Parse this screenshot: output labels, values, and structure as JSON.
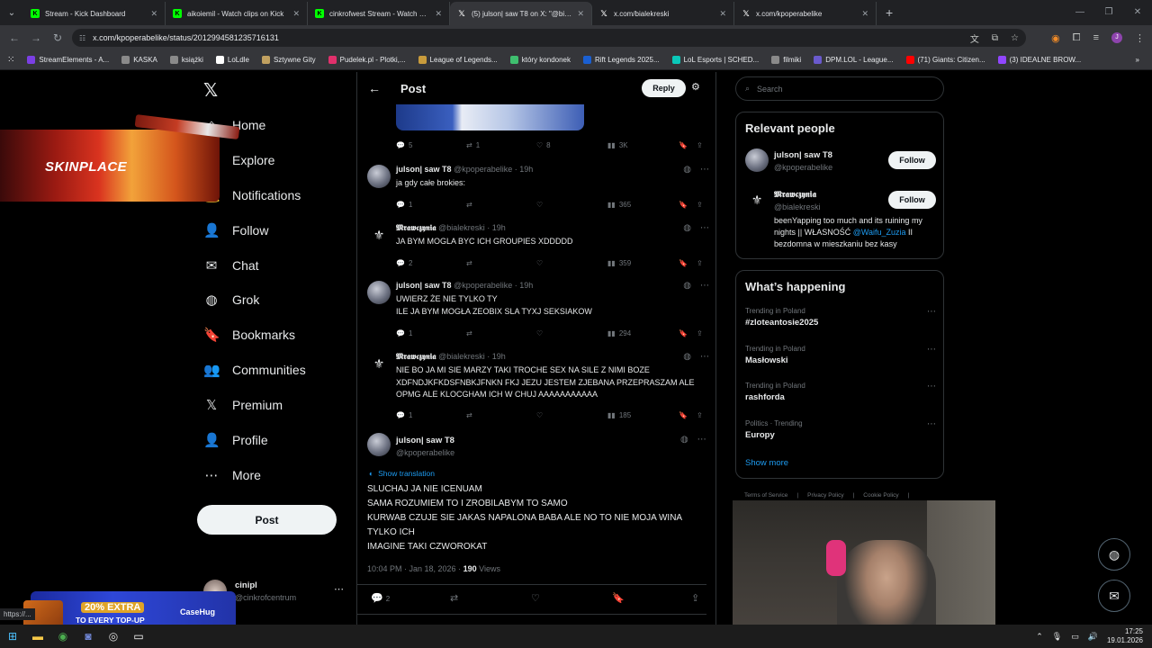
{
  "browser": {
    "tabs": [
      {
        "title": "Stream - Kick Dashboard",
        "icon": "kick-icon",
        "active": false
      },
      {
        "title": "aikoiemil - Watch clips on Kick",
        "icon": "kick-icon",
        "active": false
      },
      {
        "title": "cinkrofwest Stream - Watch Live",
        "icon": "kick-icon",
        "active": false
      },
      {
        "title": "(5) julson| saw T8 on X: \"@bialekreski",
        "icon": "x-icon",
        "active": true
      },
      {
        "title": "x.com/bialekreski",
        "icon": "x-icon",
        "active": false
      },
      {
        "title": "x.com/kpoperabelike",
        "icon": "x-icon",
        "active": false
      }
    ],
    "url": "x.com/kpoperabelike/status/2012994581235716131",
    "bookmarks": [
      "StreamElements - A...",
      "KASKA",
      "książki",
      "LoLdle",
      "Sztywne Gity",
      "Pudelek.pl - Plotki,...",
      "League of Legends...",
      "który kondonek",
      "Rift Legends 2025...",
      "LoL Esports | SCHED...",
      "filmiki",
      "DPM.LOL - League...",
      "(71) Giants: Citizen...",
      "(3) IDEALNE BROW..."
    ],
    "status_url": "https://..."
  },
  "sidebar": {
    "items": [
      {
        "label": "Home",
        "icon": "home-icon",
        "glyph": "⌂"
      },
      {
        "label": "Explore",
        "icon": "search-icon",
        "glyph": "⌕"
      },
      {
        "label": "Notifications",
        "icon": "bell-icon",
        "glyph": "🔔"
      },
      {
        "label": "Follow",
        "icon": "person-add-icon",
        "glyph": "👤"
      },
      {
        "label": "Chat",
        "icon": "mail-icon",
        "glyph": "✉"
      },
      {
        "label": "Grok",
        "icon": "grok-icon",
        "glyph": "◍"
      },
      {
        "label": "Bookmarks",
        "icon": "bookmark-icon",
        "glyph": "🔖"
      },
      {
        "label": "Communities",
        "icon": "communities-icon",
        "glyph": "👥"
      },
      {
        "label": "Premium",
        "icon": "x-premium-icon",
        "glyph": "𝕏"
      },
      {
        "label": "Profile",
        "icon": "profile-icon",
        "glyph": "👤"
      },
      {
        "label": "More",
        "icon": "more-icon",
        "glyph": "⋯"
      }
    ],
    "post_label": "Post",
    "account": {
      "name": "cinipl",
      "handle": "@cinkrofcentrum"
    }
  },
  "header": {
    "title": "Post",
    "reply_label": "Reply"
  },
  "top_actions": {
    "replies": "5",
    "reposts": "1",
    "likes": "8",
    "views": "3K"
  },
  "replies": [
    {
      "name": "julson| saw T8",
      "handle": "@kpoperabelike · 19h",
      "text": "ja gdy całe brokies:",
      "replies": "1",
      "reposts": "",
      "likes": "",
      "views": "365",
      "avatar": "photo"
    },
    {
      "name": "𝕸𝖗𝖆𝖜𝖈𝖟𝖞𝖓𝖎𝖆",
      "handle": "@bialekreski · 19h",
      "text": "JA BYM MOGLA BYC ICH GROUPIES XDDDDD",
      "replies": "2",
      "reposts": "",
      "likes": "",
      "views": "359",
      "avatar": "gothic"
    },
    {
      "name": "julson| saw T8",
      "handle": "@kpoperabelike · 19h",
      "text": "UWIERZ ŻE NIE TYLKO TY\nILE JA BYM MOGŁA ZEOBIX SLA TYXJ SEKSIAKOW",
      "replies": "1",
      "reposts": "",
      "likes": "",
      "views": "294",
      "avatar": "photo"
    },
    {
      "name": "𝕸𝖗𝖆𝖜𝖈𝖟𝖞𝖓𝖎𝖆",
      "handle": "@bialekreski · 19h",
      "text": "NIE BO JA MI SIE MARZY TAKI TROCHE SEX NA SILE Z NIMI BOZE\nXDFNDJKFKDSFNBKJFNKN FKJ JEZU JESTEM ZJEBANA PRZEPRASZAM ALE\nOPMG ALE KLOCGHAM ICH W CHUJ AAAAAAAAAAA",
      "replies": "1",
      "reposts": "",
      "likes": "",
      "views": "185",
      "avatar": "gothic"
    }
  ],
  "main_post": {
    "name": "julson| saw T8",
    "handle": "@kpoperabelike",
    "show_translation": "Show translation",
    "text": "SLUCHAJ JA NIE ICENUAM\nSAMA ROZUMIEM TO I ZROBILABYM TO SAMO\nKURWAB CZUJE SIE JAKAS NAPALONA BABA ALE NO TO NIE MOJA WINA\nTYLKO ICH\nIMAGINE TAKI CZWOROKAT",
    "timestamp": "10:04 PM · Jan 18, 2026 · ",
    "views": "190",
    "views_label": "Views",
    "replies": "2"
  },
  "right": {
    "search_placeholder": "Search",
    "relevant_title": "Relevant people",
    "people": [
      {
        "name": "julson| saw T8",
        "handle": "@kpoperabelike",
        "follow": "Follow",
        "bio": "",
        "bio_link": "",
        "bio_tail": "",
        "avatar": "photo"
      },
      {
        "name": "𝕸𝖗𝖆𝖜𝖈𝖟𝖞𝖓𝖎𝖆",
        "handle": "@bialekreski",
        "follow": "Follow",
        "bio": "beenYapping too much and its ruining my nights || WŁASNOŚĆ ",
        "bio_link": "@Waifu_Zuzia",
        "bio_tail": " II bezdomna w mieszkaniu bez kasy",
        "avatar": "gothic"
      }
    ],
    "happening_title": "What’s happening",
    "trends": [
      {
        "context": "Trending in Poland",
        "name": "#zloteantosie2025"
      },
      {
        "context": "Trending in Poland",
        "name": "Masłowski"
      },
      {
        "context": "Trending in Poland",
        "name": "rashforda"
      },
      {
        "context": "Politics · Trending",
        "name": "Europy"
      }
    ],
    "show_more": "Show more",
    "footer": [
      "Terms of Service",
      "|",
      "Privacy Policy",
      "|",
      "Cookie Policy",
      "|"
    ]
  },
  "ads": {
    "skinplace": "SKINPLACE",
    "casehug_line1": "20% EXTRA",
    "casehug_line2": "TO EVERY TOP-UP",
    "casehug_logo": "CaseHug"
  },
  "taskbar": {
    "time": "17:25",
    "date": "19.01.2026"
  }
}
